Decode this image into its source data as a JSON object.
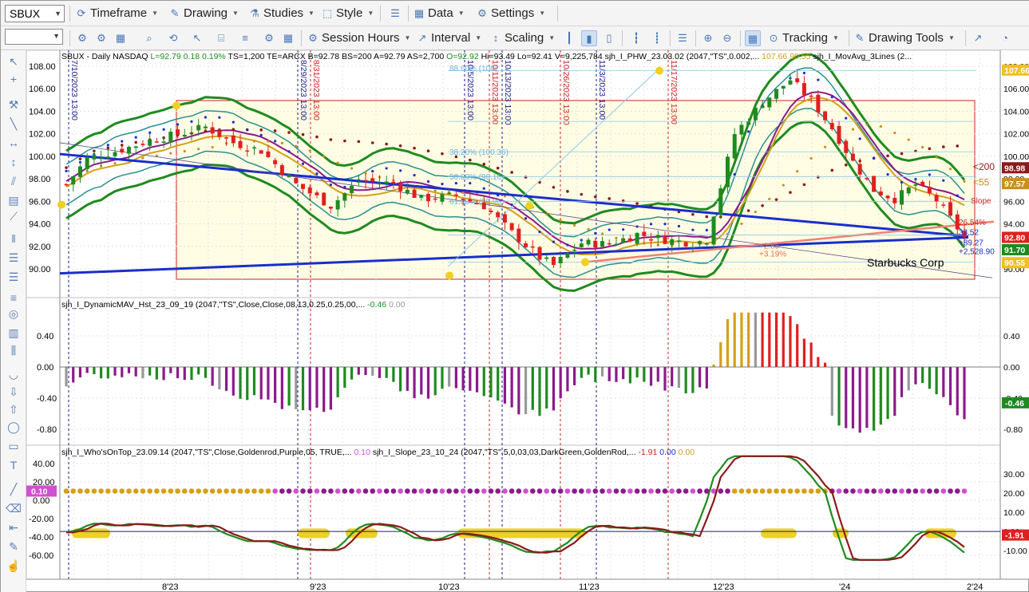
{
  "symbol": "SBUX",
  "toolbar1": {
    "timeframe": "Timeframe",
    "drawing": "Drawing",
    "studies": "Studies",
    "style": "Style",
    "data": "Data",
    "settings": "Settings"
  },
  "toolbar2": {
    "session_hours": "Session Hours",
    "interval": "Interval",
    "scaling": "Scaling",
    "tracking": "Tracking",
    "drawing_tools": "Drawing Tools"
  },
  "price_panel": {
    "header_parts": [
      {
        "text": "SBUX - Daily  NASDAQ  ",
        "color": "#000000"
      },
      {
        "text": "L=92.79  0.18  0.19%",
        "color": "#1a8a1a"
      },
      {
        "text": "  TS=1,200  TE=ARCX  B=92.78  BS=200  A=92.79  AS=2,700  ",
        "color": "#000000"
      },
      {
        "text": "O=92.92",
        "color": "#1a8a1a"
      },
      {
        "text": "  Hi=93.49  Lo=92.41  V=9,225,784  sjh_I_PHW_23.03.02 (2047,\"TS\",0.002,...  ",
        "color": "#000000"
      },
      {
        "text": "107.66",
        "color": "#d4a017"
      },
      {
        "text": "  ",
        "color": "#000000"
      },
      {
        "text": "90.55",
        "color": "#d4a017"
      },
      {
        "text": "  sjh_I_MovAvg_3Lines (2...",
        "color": "#000000"
      }
    ],
    "y_ticks": [
      "108.00",
      "106.00",
      "104.00",
      "102.00",
      "100.00",
      "98.00",
      "96.00",
      "94.00",
      "92.00",
      "90.00"
    ],
    "right_ticks": [
      "108.00",
      "106.00",
      "104.00",
      "102.00",
      "100.00",
      "98.00",
      "96.00",
      "94.00",
      "92.00",
      "90.00"
    ],
    "badges": [
      {
        "text": "107.66",
        "bg": "#f0c020",
        "fg": "#ffffff",
        "value": 107.66
      },
      {
        "text": "98.98",
        "bg": "#8b1a1a",
        "fg": "#ffffff",
        "value": 98.98
      },
      {
        "text": "97.57",
        "bg": "#c8901c",
        "fg": "#ffffff",
        "value": 97.57
      },
      {
        "text": "92.80",
        "bg": "#e02020",
        "fg": "#ffffff",
        "value": 92.8
      },
      {
        "text": "91.70",
        "bg": "#1f8a1f",
        "fg": "#ffffff",
        "value": 91.7
      },
      {
        "text": "90.55",
        "bg": "#f0c020",
        "fg": "#ffffff",
        "value": 90.55
      }
    ],
    "company_label": "Starbucks Corp",
    "date_markers": [
      "7/10/2023 13:00",
      "8/29/2023 13:00",
      "8/31/2023 13:00",
      "10/5/2023 13:00",
      "10/11/2023 13:00",
      "10/13/2023 13:00",
      "10/26/2023 13:00",
      "11/3/2023 13:00",
      "11/17/2023 13:00"
    ],
    "fib_labels": [
      "38.20% (100.36)",
      "50.00% (98.16)",
      "61.80% (95.96)",
      "88.60% (108)"
    ],
    "annotations": [
      "<200",
      "<55",
      "Slope",
      "26.54%",
      "33.52",
      "+2.85",
      "+3.19%",
      "+89.27",
      "+2,528.90"
    ]
  },
  "panel2": {
    "header_main": "sjh_I_DynamicMAV_Hst_23_09_19 (2047,\"TS\",Close,Close,08,13,0.25,0.25,00,...",
    "value1": "-0.46",
    "value2": "0.00",
    "y_ticks": [
      "0.40",
      "0.00",
      "-0.40",
      "-0.80"
    ],
    "badge": "-0.46"
  },
  "panel3": {
    "header_main": "sjh_I_Who'sOnTop_23.09.14 (2047,\"TS\",Close,Goldenrod,Purple,05,  TRUE,...",
    "value1": "0.10",
    "header_second": "sjh_I_Slope_23_10_24 (2047,\"TS\",5,0,03,03,DarkGreen,GoldenRod,...",
    "v_neg": "-1.91",
    "v_b": "0.00",
    "v_c": "0.00",
    "left_ticks": [
      "40.00",
      "20.00",
      "0.00",
      "-20.00",
      "-40.00",
      "-60.00"
    ],
    "right_ticks": [
      "30.00",
      "20.00",
      "10.00",
      "0.00",
      "-10.00"
    ],
    "left_badge": "0.10",
    "right_badge": "-1.91"
  },
  "x_axis": [
    "8'23",
    "9'23",
    "10'23",
    "11'23",
    "12'23",
    "'24",
    "2'24"
  ],
  "colors": {
    "accent": "#4a78b8",
    "up": "#1f8a1f",
    "down": "#e02020",
    "purple": "#8b1a8b",
    "goldenrod": "#d4a017",
    "navy_line": "#1a2ecc"
  }
}
